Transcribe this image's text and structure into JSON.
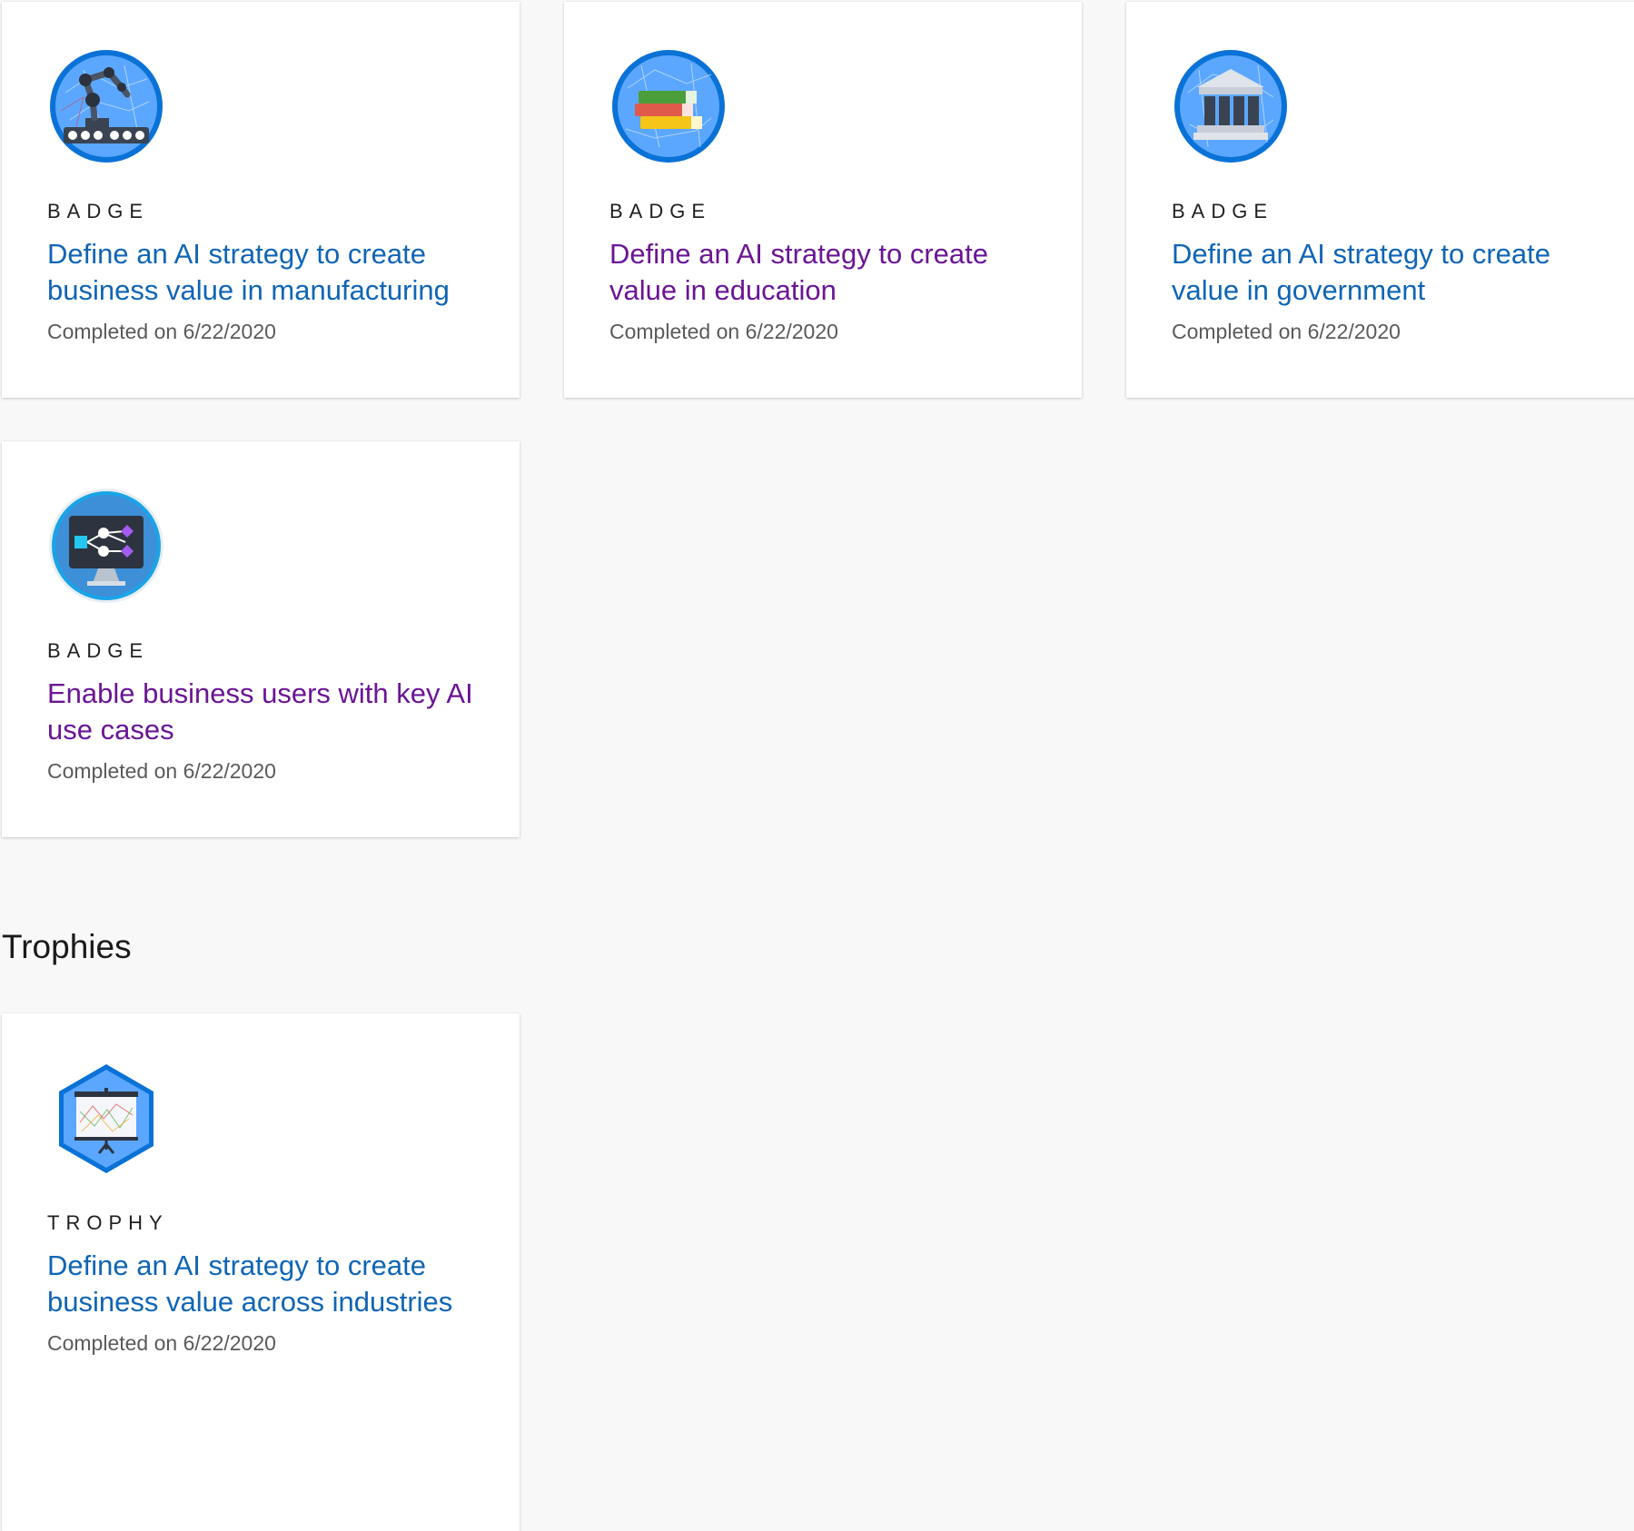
{
  "badges": [
    {
      "icon": "robot-arm-icon",
      "kind": "BADGE",
      "title": "Define an AI strategy to create business value in manufacturing",
      "completed": "Completed on 6/22/2020",
      "link_color": "#0f65b5"
    },
    {
      "icon": "books-icon",
      "kind": "BADGE",
      "title": "Define an AI strategy to create value in education",
      "completed": "Completed on 6/22/2020",
      "link_color": "#6b1595"
    },
    {
      "icon": "government-building-icon",
      "kind": "BADGE",
      "title": "Define an AI strategy to create value in government",
      "completed": "Completed on 6/22/2020",
      "link_color": "#0f65b5"
    },
    {
      "icon": "workflow-monitor-icon",
      "kind": "BADGE",
      "title": "Enable business users with key AI use cases",
      "completed": "Completed on 6/22/2020",
      "link_color": "#6b1595"
    }
  ],
  "trophies_section": {
    "heading": "Trophies",
    "items": [
      {
        "icon": "presentation-board-icon",
        "kind": "TROPHY",
        "title": "Define an AI strategy to create business value across industries",
        "completed": "Completed on 6/22/2020",
        "link_color": "#0f65b5"
      }
    ]
  },
  "colors": {
    "page_background": "#f8f8f8",
    "card_background": "#ffffff",
    "link_blue": "#0f65b5",
    "link_visited_purple": "#6b1595",
    "badge_ring_blue": "#0a72d6",
    "badge_fill_blue": "#5ba7ff"
  }
}
